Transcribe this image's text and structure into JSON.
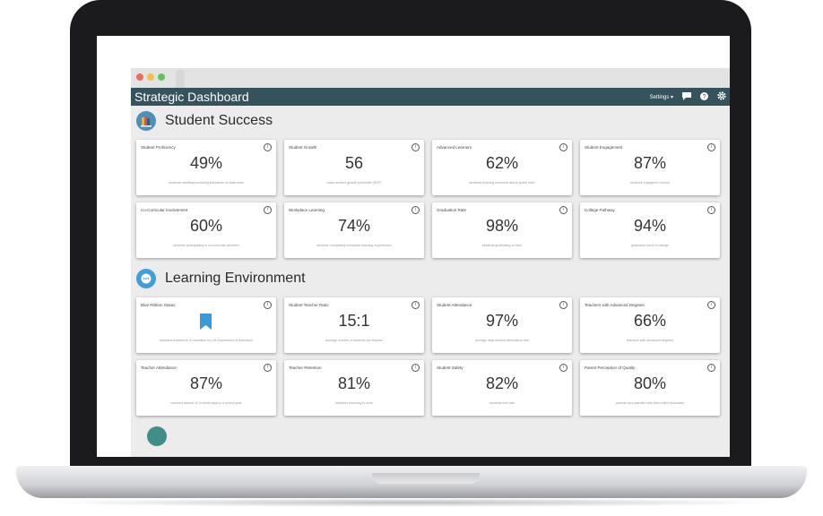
{
  "app": {
    "title": "Strategic Dashboard",
    "settings_label": "Settings ▾",
    "accent": "#35535d"
  },
  "sections": [
    {
      "title": "Student Success",
      "icon": "books-icon",
      "cards": [
        {
          "label": "Student Proficiency",
          "value": "49%",
          "desc": "students meeting/exceeding standards on state tests"
        },
        {
          "label": "Student Growth",
          "value": "56",
          "desc": "mean student growth percentile (SGP)"
        },
        {
          "label": "Advanced Learners",
          "value": "62%",
          "desc": "students learning one/more above grade level"
        },
        {
          "label": "Student Engagement",
          "value": "87%",
          "desc": "students engaged in school"
        },
        {
          "label": "Co-Curricular Involvement",
          "value": "60%",
          "desc": "students participating in co-curricular activities"
        },
        {
          "label": "Workplace Learning",
          "value": "74%",
          "desc": "students completing workplace learning experiences"
        },
        {
          "label": "Graduation Rate",
          "value": "98%",
          "desc": "students graduating on time"
        },
        {
          "label": "College Pathway",
          "value": "94%",
          "desc": "graduates enroll in college"
        }
      ]
    },
    {
      "title": "Learning Environment",
      "icon": "chat-bubble-icon",
      "cards": [
        {
          "label": "Blue Ribbon Status",
          "value": "",
          "desc": "awarded excellence in education by US Department of Education",
          "ribbon": true
        },
        {
          "label": "Student Teacher Ratio",
          "value": "15:1",
          "desc": "average number of students per teacher"
        },
        {
          "label": "Student Attendance",
          "value": "97%",
          "desc": "average daily student attendance rate"
        },
        {
          "label": "Teachers with Advanced Degrees",
          "value": "66%",
          "desc": "teachers with advanced degrees"
        },
        {
          "label": "Teacher Attendance",
          "value": "87%",
          "desc": "teachers absent 10 or fewer days in a school year"
        },
        {
          "label": "Teacher Retention",
          "value": "81%",
          "desc": "teachers returning to work"
        },
        {
          "label": "Student Safety",
          "value": "82%",
          "desc": "students feel safe"
        },
        {
          "label": "Parent Perception of Quality",
          "value": "80%",
          "desc": "parents very satisfied with their child's education"
        }
      ]
    }
  ]
}
